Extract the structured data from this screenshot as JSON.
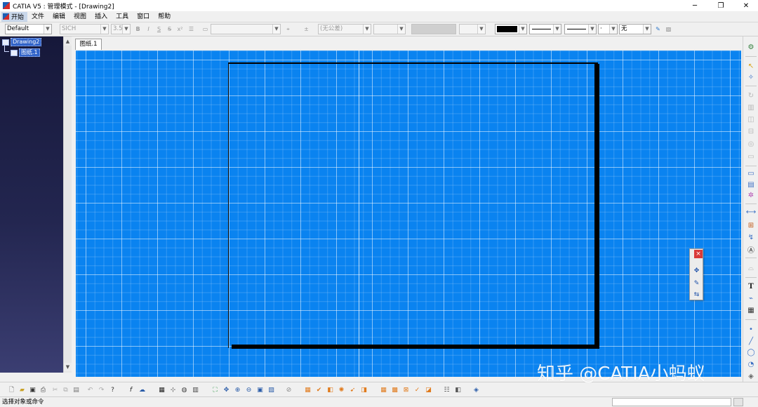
{
  "window": {
    "title": "CATIA V5 : 管理模式 - [Drawing2]",
    "minimize": "─",
    "restore": "❐",
    "close": "✕"
  },
  "menu": {
    "start": "开始",
    "items": [
      "文件",
      "编辑",
      "视图",
      "插入",
      "工具",
      "窗口",
      "帮助"
    ]
  },
  "format_toolbar": {
    "style": "Default",
    "font": "SICH",
    "font_size": "3.5",
    "bold": "B",
    "italic": "I",
    "underline": "S",
    "strike": "S",
    "tolerance": "(无公差)",
    "line_pattern_none": "无",
    "point_style": "·"
  },
  "tree": {
    "root": "Drawing2",
    "child": "图纸.1"
  },
  "tabs": {
    "sheet": "图纸.1"
  },
  "float_toolbar": {
    "close": "×"
  },
  "status": {
    "text": "选择对象或命令"
  },
  "watermark": "知乎 @CATIA小蚂蚁",
  "colors": {
    "canvas": "#0a83f0",
    "tree_bg": "#1e2046",
    "selected": "#3163c8"
  }
}
